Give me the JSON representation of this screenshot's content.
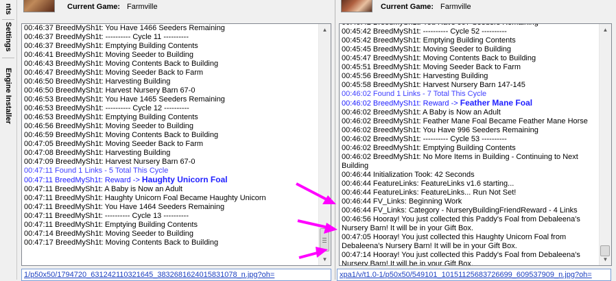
{
  "sidebar": {
    "tabs": [
      {
        "label": "nts"
      },
      {
        "label": "Settings"
      },
      {
        "label": "Engine Installer"
      }
    ]
  },
  "panels": [
    {
      "current_game_label": "Current Game:",
      "game_name": "Farmville",
      "log_lines": [
        {
          "text": "00:46:37 BreedMySh1t: You Have 1466 Seeders Remaining",
          "style": "normal"
        },
        {
          "text": "00:46:37 BreedMySh1t: ---------- Cycle 11 ----------",
          "style": "normal"
        },
        {
          "text": "00:46:37 BreedMySh1t: Emptying Building Contents",
          "style": "normal"
        },
        {
          "text": "00:46:41 BreedMySh1t: Moving Seeder to Building",
          "style": "normal"
        },
        {
          "text": "00:46:43 BreedMySh1t: Moving Contents Back to Building",
          "style": "normal"
        },
        {
          "text": "00:46:47 BreedMySh1t: Moving Seeder Back to Farm",
          "style": "normal"
        },
        {
          "text": "00:46:50 BreedMySh1t: Harvesting Building",
          "style": "normal"
        },
        {
          "text": "00:46:50 BreedMySh1t: Harvest Nursery Barn 67-0",
          "style": "normal"
        },
        {
          "text": "00:46:53 BreedMySh1t: You Have 1465 Seeders Remaining",
          "style": "normal"
        },
        {
          "text": "00:46:53 BreedMySh1t: ---------- Cycle 12 ----------",
          "style": "normal"
        },
        {
          "text": "00:46:53 BreedMySh1t: Emptying Building Contents",
          "style": "normal"
        },
        {
          "text": "00:46:56 BreedMySh1t: Moving Seeder to Building",
          "style": "normal"
        },
        {
          "text": "00:46:59 BreedMySh1t: Moving Contents Back to Building",
          "style": "normal"
        },
        {
          "text": "00:47:05 BreedMySh1t: Moving Seeder Back to Farm",
          "style": "normal"
        },
        {
          "text": "00:47:08 BreedMySh1t: Harvesting Building",
          "style": "normal"
        },
        {
          "text": "00:47:09 BreedMySh1t: Harvest Nursery Barn 67-0",
          "style": "normal"
        },
        {
          "text": "00:47:11 Found 1 Links - 5 Total This Cycle",
          "style": "link"
        },
        {
          "text": "00:47:11 BreedMySh1t: Reward -> ",
          "bold": "Haughty Unicorn Foal",
          "style": "reward"
        },
        {
          "text": "00:47:11 BreedMySh1t: A Baby is Now an Adult",
          "style": "normal"
        },
        {
          "text": "00:47:11 BreedMySh1t: Haughty Unicorn Foal Became Haughty Unicorn",
          "style": "normal"
        },
        {
          "text": "00:47:11 BreedMySh1t: You Have 1464 Seeders Remaining",
          "style": "normal"
        },
        {
          "text": "00:47:11 BreedMySh1t: ---------- Cycle 13 ----------",
          "style": "normal"
        },
        {
          "text": "00:47:11 BreedMySh1t: Emptying Building Contents",
          "style": "normal"
        },
        {
          "text": "00:47:14 BreedMySh1t: Moving Seeder to Building",
          "style": "normal"
        },
        {
          "text": "00:47:17 BreedMySh1t: Moving Contents Back to Building",
          "style": "normal"
        }
      ],
      "url_text": "1/p50x50/1794720_631242110321645_3832681624015831078_n.jpg?oh="
    },
    {
      "current_game_label": "Current Game:",
      "game_name": "Farmville",
      "log_lines": [
        {
          "text": "00:45:42 BreedMySh1t: You Have 997 Seeders Remaining",
          "style": "normal"
        },
        {
          "text": "00:45:42 BreedMySh1t: ---------- Cycle 52 ----------",
          "style": "normal"
        },
        {
          "text": "00:45:42 BreedMySh1t: Emptying Building Contents",
          "style": "normal"
        },
        {
          "text": "00:45:45 BreedMySh1t: Moving Seeder to Building",
          "style": "normal"
        },
        {
          "text": "00:45:47 BreedMySh1t: Moving Contents Back to Building",
          "style": "normal"
        },
        {
          "text": "00:45:51 BreedMySh1t: Moving Seeder Back to Farm",
          "style": "normal"
        },
        {
          "text": "00:45:56 BreedMySh1t: Harvesting Building",
          "style": "normal"
        },
        {
          "text": "00:45:58 BreedMySh1t: Harvest Nursery Barn 147-145",
          "style": "normal"
        },
        {
          "text": "00:46:02 Found 1 Links - 7 Total This Cycle",
          "style": "link"
        },
        {
          "text": "00:46:02 BreedMySh1t: Reward -> ",
          "bold": "Feather Mane Foal",
          "style": "reward"
        },
        {
          "text": "00:46:02 BreedMySh1t: A Baby is Now an Adult",
          "style": "normal"
        },
        {
          "text": "00:46:02 BreedMySh1t: Feather Mane Foal Became Feather Mane Horse",
          "style": "normal"
        },
        {
          "text": "00:46:02 BreedMySh1t: You Have 996 Seeders Remaining",
          "style": "normal"
        },
        {
          "text": "00:46:02 BreedMySh1t: ---------- Cycle 53 ----------",
          "style": "normal"
        },
        {
          "text": "00:46:02 BreedMySh1t: Emptying Building Contents",
          "style": "normal"
        },
        {
          "text": "00:46:02 BreedMySh1t: No More Items in Building - Continuing to Next Building",
          "style": "normal"
        },
        {
          "text": "00:46:44 Initialization Took: 42 Seconds",
          "style": "normal"
        },
        {
          "text": "00:46:44 FeatureLinks: FeatureLinks v1.6 starting...",
          "style": "normal"
        },
        {
          "text": "00:46:44 FeatureLinks: FeatureLinks... Run Not Set!",
          "style": "normal"
        },
        {
          "text": "00:46:44 FV_Links: Beginning Work",
          "style": "normal"
        },
        {
          "text": "00:46:44 FV_Links: Category - NurseryBuildingFriendReward - 4 Links",
          "style": "normal"
        },
        {
          "text": "00:46:56 Hooray! You just collected this Paddy's Foal from Debaleena's Nursery Barn! It will be in your Gift Box.",
          "style": "normal"
        },
        {
          "text": "00:47:05 Hooray! You just collected this Haughty Unicorn Foal from Debaleena's Nursery Barn! It will be in your Gift Box.",
          "style": "normal"
        },
        {
          "text": "00:47:14 Hooray! You just collected this Paddy's Foal from Debaleena's Nursery Barn! It will be in your Gift Box.",
          "style": "normal"
        }
      ],
      "url_text": "xpa1/v/t1.0-1/p50x50/549101_10151125683726699_609537909_n.jpg?oh="
    }
  ],
  "colors": {
    "link": "#4040ff",
    "reward": "#2020ff",
    "annotation_arrow": "#ff00ff"
  }
}
